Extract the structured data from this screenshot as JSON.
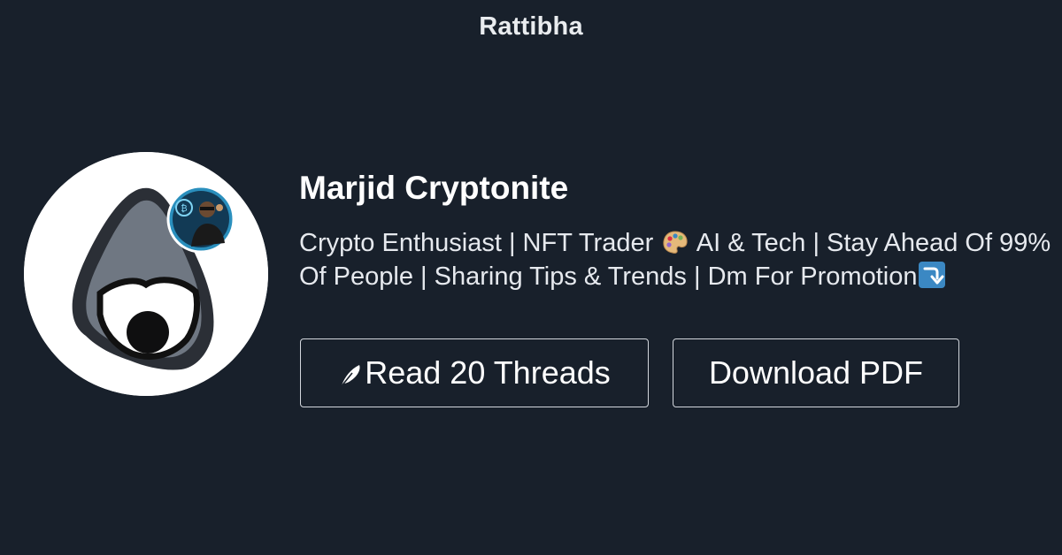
{
  "brand": {
    "name": "Rattibha"
  },
  "profile": {
    "name": "Marjid Cryptonite",
    "bio_part1": "Crypto Enthusiast | NFT Trader",
    "bio_part2": "AI & Tech | Stay Ahead Of 99% Of People | Sharing Tips & Trends | Dm For Promotion",
    "bio_icons": [
      "artist-palette-icon",
      "right-arrow-curving-down-icon"
    ]
  },
  "actions": {
    "read_label": "Read 20 Threads",
    "read_icon": "feather-icon",
    "download_label": "Download PDF"
  },
  "colors": {
    "background": "#18202b",
    "text": "#ffffff",
    "button_border": "#d3d7dd",
    "arrow_badge": "#3b88c3"
  }
}
